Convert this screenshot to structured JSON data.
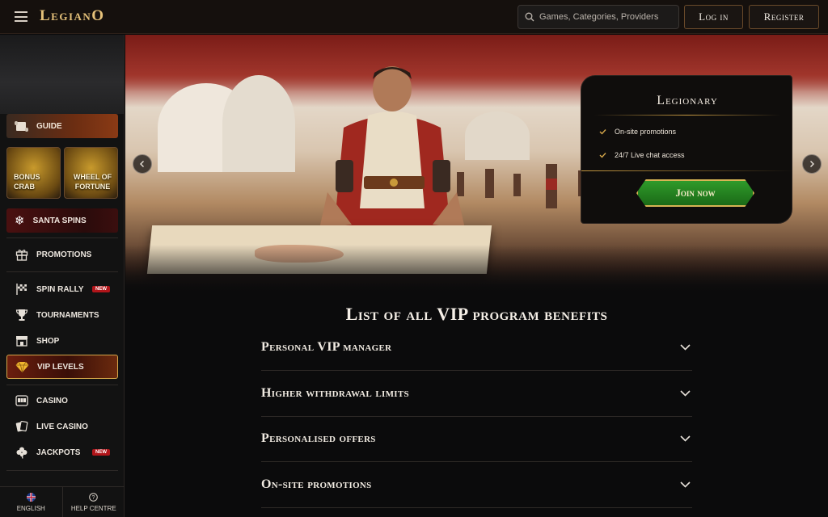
{
  "header": {
    "logo": "LegianO",
    "search_placeholder": "Games, Categories, Providers",
    "login_label": "Log in",
    "register_label": "Register"
  },
  "sidebar": {
    "guide_label": "GUIDE",
    "tiles": [
      {
        "label_line1": "BONUS",
        "label_line2": "CRAB"
      },
      {
        "label_line1": "WHEEL OF",
        "label_line2": "FORTUNE"
      }
    ],
    "santa_label": "SANTA SPINS",
    "items": [
      {
        "label": "PROMOTIONS",
        "icon": "gift-icon"
      },
      {
        "label": "SPIN RALLY",
        "icon": "checkered-flag-icon",
        "badge": "NEW"
      },
      {
        "label": "TOURNAMENTS",
        "icon": "trophy-icon"
      },
      {
        "label": "SHOP",
        "icon": "shop-icon"
      },
      {
        "label": "VIP LEVELS",
        "icon": "diamond-icon"
      },
      {
        "label": "CASINO",
        "icon": "slot-machine-icon"
      },
      {
        "label": "LIVE CASINO",
        "icon": "cards-icon"
      },
      {
        "label": "JACKPOTS",
        "icon": "clover-icon",
        "badge": "NEW"
      }
    ],
    "bottom": {
      "language_label": "ENGLISH",
      "help_label": "HELP CENTRE"
    }
  },
  "hero": {
    "vip_card": {
      "title": "Legionary",
      "benefits": [
        "On-site promotions",
        "24/7 Live chat access"
      ],
      "join_label": "Join now"
    }
  },
  "main": {
    "title": "List of all VIP program benefits",
    "accordion": [
      {
        "label": "Personal VIP manager"
      },
      {
        "label": "Higher withdrawal limits"
      },
      {
        "label": "Personalised offers"
      },
      {
        "label": "On-site promotions"
      }
    ]
  },
  "colors": {
    "accent_gold": "#d4a64a",
    "join_green": "#2f9a2a",
    "badge_red": "#b1151a",
    "background": "#0b0b0c"
  }
}
